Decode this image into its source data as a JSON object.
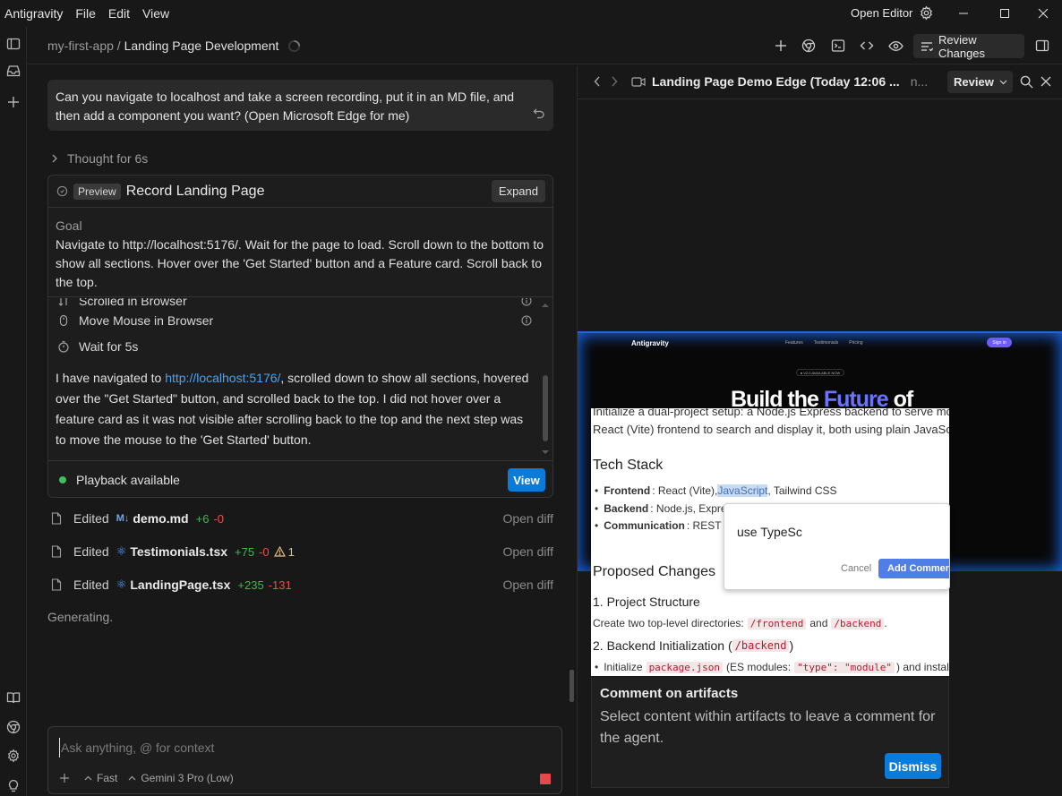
{
  "app": {
    "name": "Antigravity",
    "menu": [
      "File",
      "Edit",
      "View"
    ],
    "open_editor": "Open Editor"
  },
  "breadcrumb": {
    "project": "my-first-app",
    "separator": "/",
    "conversation": "Landing Page Development"
  },
  "header": {
    "review_changes": "Review Changes"
  },
  "chat": {
    "user_message": "Can you navigate to localhost and take a screen recording, put it in an MD file, and then add a component you want? (Open Microsoft Edge for me)",
    "thought": "Thought for 6s",
    "task": {
      "badge": "Preview",
      "title": "Record Landing Page",
      "expand": "Expand",
      "goal_label": "Goal",
      "goal_text": "Navigate to http://localhost:5176/. Wait for the page to load. Scroll down to the bottom to show all sections. Hover over the 'Get Started' button and a Feature card. Scroll back to the top.",
      "steps": [
        {
          "label": "Scrolled in Browser",
          "icon": "scroll-icon"
        },
        {
          "label": "Move Mouse in Browser",
          "icon": "mouse-icon"
        },
        {
          "label": "Wait for 5s",
          "icon": "timer-icon"
        }
      ],
      "summary_before": "I have navigated to ",
      "summary_link": "http://localhost:5176/",
      "summary_after": ", scrolled down to show all sections, hovered over the \"Get Started\" button, and scrolled back to the top. I did not hover over a feature card as it was not visible after scrolling back to the top and the next step was to move the mouse to the 'Get Started' button.",
      "playback": "Playback available",
      "view": "View"
    },
    "edits": [
      {
        "label": "Edited",
        "icon": "markdown-icon",
        "icon_text": "M↓",
        "file": "demo.md",
        "add": "+6",
        "del": "-0",
        "warn": "",
        "open": "Open diff"
      },
      {
        "label": "Edited",
        "icon": "react-icon",
        "icon_text": "⚛",
        "file": "Testimonials.tsx",
        "add": "+75",
        "del": "-0",
        "warn": "1",
        "open": "Open diff"
      },
      {
        "label": "Edited",
        "icon": "react-icon",
        "icon_text": "⚛",
        "file": "LandingPage.tsx",
        "add": "+235",
        "del": "-131",
        "warn": "",
        "open": "Open diff"
      }
    ],
    "status": "Generating.",
    "input_placeholder": "Ask anything, @ for context",
    "mode": "Fast",
    "model": "Gemini 3 Pro (Low)"
  },
  "preview": {
    "title": "Landing Page Demo Edge (Today 12:06 ...",
    "title_extra": "n...",
    "review": "Review",
    "video": {
      "logo": "Antigravity",
      "nav": [
        "Features",
        "Testimonials",
        "Pricing"
      ],
      "signin": "Sign in",
      "badge": "● V2.0 AVAILABLE NOW",
      "hero_white": "Build the ",
      "hero_accent": "Future",
      "hero_white2": " of"
    },
    "doc": {
      "intro1": "Initialize a dual-project setup: a Node.js Express backend to serve mock",
      "intro2": "React (Vite) frontend to search and display it, both using plain JavaScript",
      "tech_heading": "Tech Stack",
      "frontend_label": "Frontend",
      "frontend_pre": ": React (Vite), ",
      "frontend_hl": "JavaScript",
      "frontend_post": ", Tailwind CSS",
      "backend_label": "Backend",
      "backend_text": ": Node.js, Expre",
      "comm_label": "Communication",
      "comm_text": ": REST",
      "changes_heading": "Proposed Changes",
      "structure_heading": "1. Project Structure",
      "structure_text": "Create two top-level directories:",
      "dir_frontend": "/frontend",
      "and": "and",
      "dir_backend": "/backend",
      "period": ".",
      "backend_init_heading": "2. Backend Initialization (",
      "backend_init_code": "/backend",
      "backend_init_close": ")",
      "init_pre": "Initialize",
      "init_code": "package.json",
      "init_mid": "(ES modules:",
      "init_code2": "\"type\": \"module\"",
      "init_post": ") and instal"
    },
    "comment": {
      "value": "use TypeSc",
      "cancel": "Cancel",
      "add": "Add Comment"
    },
    "comment_panel": {
      "title": "Comment on artifacts",
      "text": "Select content within artifacts to leave a comment for the agent.",
      "dismiss": "Dismiss"
    }
  }
}
